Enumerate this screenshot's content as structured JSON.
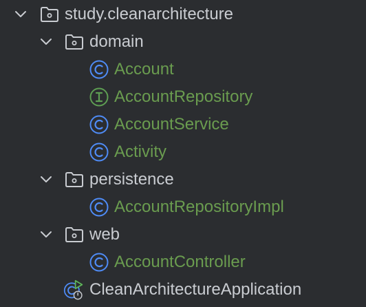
{
  "project_tree": {
    "root": {
      "label": "study.cleanarchitecture",
      "icon": "package-folder-icon",
      "expanded": true
    },
    "items": [
      {
        "label": "domain",
        "type": "package",
        "icon": "package-folder-icon",
        "expanded": true
      },
      {
        "label": "Account",
        "type": "class",
        "icon": "class-icon"
      },
      {
        "label": "AccountRepository",
        "type": "interface",
        "icon": "interface-icon"
      },
      {
        "label": "AccountService",
        "type": "class",
        "icon": "class-icon"
      },
      {
        "label": "Activity",
        "type": "class",
        "icon": "class-icon"
      },
      {
        "label": "persistence",
        "type": "package",
        "icon": "package-folder-icon",
        "expanded": true
      },
      {
        "label": "AccountRepositoryImpl",
        "type": "class",
        "icon": "class-icon"
      },
      {
        "label": "web",
        "type": "package",
        "icon": "package-folder-icon",
        "expanded": true
      },
      {
        "label": "AccountController",
        "type": "class",
        "icon": "class-icon"
      },
      {
        "label": "CleanArchitectureApplication",
        "type": "spring-boot-application",
        "icon": "spring-boot-run-class-icon"
      }
    ]
  },
  "colors": {
    "background": "#2b2d30",
    "folder_text": "#c9ccd1",
    "class_text": "#6a9c4f",
    "class_icon": "#4f8cf7",
    "interface_icon": "#5e9e53",
    "run_icon": "#5fb85a"
  }
}
